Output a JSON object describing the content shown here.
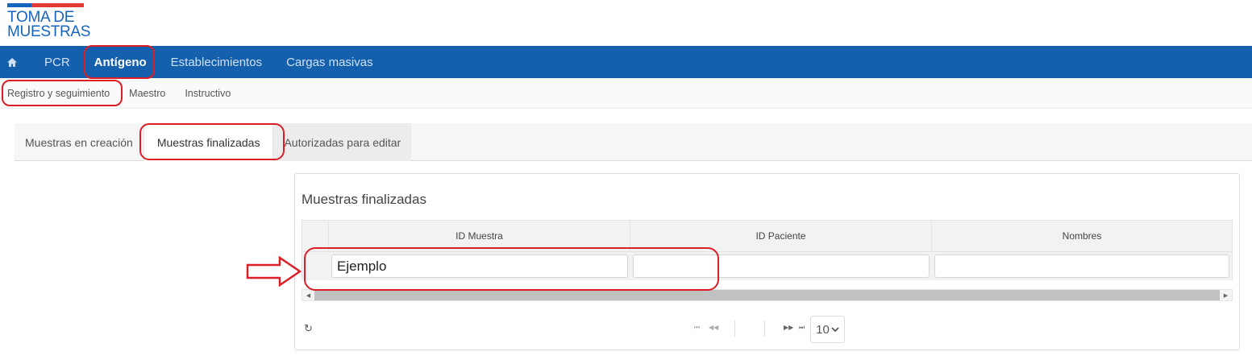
{
  "logo": {
    "line1": "TOMA DE",
    "line2": "MUESTRAS"
  },
  "topnav": {
    "home_icon": "home-icon",
    "items": [
      {
        "label": "PCR"
      },
      {
        "label": "Antígeno"
      },
      {
        "label": "Establecimientos"
      },
      {
        "label": "Cargas masivas"
      }
    ]
  },
  "subnav": {
    "items": [
      {
        "label": "Registro y seguimiento"
      },
      {
        "label": "Maestro"
      },
      {
        "label": "Instructivo"
      }
    ]
  },
  "tabs": [
    {
      "label": "Muestras en creación"
    },
    {
      "label": "Muestras finalizadas"
    },
    {
      "label": "Autorizadas para editar"
    }
  ],
  "panel": {
    "title": "Muestras finalizadas",
    "columns": [
      {
        "label": "ID Muestra"
      },
      {
        "label": "ID Paciente"
      },
      {
        "label": "Nombres"
      }
    ],
    "filters": [
      {
        "value": "Ejemplo"
      },
      {
        "value": ""
      },
      {
        "value": ""
      }
    ],
    "pager": {
      "page_size": "10"
    }
  },
  "colors": {
    "nav_blue": "#1560ad",
    "annotation_red": "#dc1f26"
  }
}
